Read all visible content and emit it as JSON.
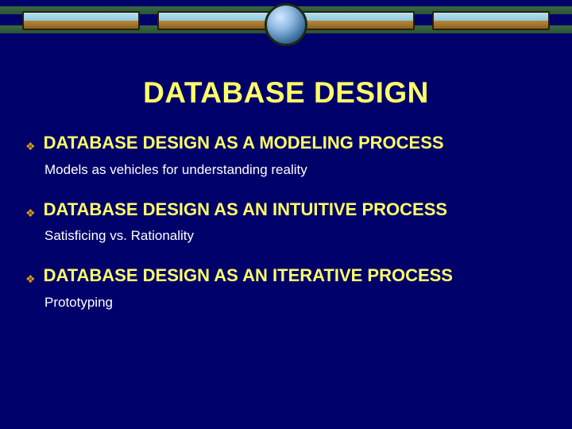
{
  "colors": {
    "background": "#00006b",
    "title": "#ffff66",
    "heading": "#ffff66",
    "subtext": "#ffffff",
    "bullet": "#d4a017"
  },
  "slide": {
    "title": "DATABASE DESIGN",
    "items": [
      {
        "heading": "DATABASE DESIGN AS A MODELING PROCESS",
        "subtext": "Models as vehicles for understanding reality"
      },
      {
        "heading": "DATABASE DESIGN AS AN INTUITIVE PROCESS",
        "subtext": "Satisficing vs. Rationality"
      },
      {
        "heading": "DATABASE DESIGN AS AN ITERATIVE PROCESS",
        "subtext": "Prototyping"
      }
    ]
  }
}
